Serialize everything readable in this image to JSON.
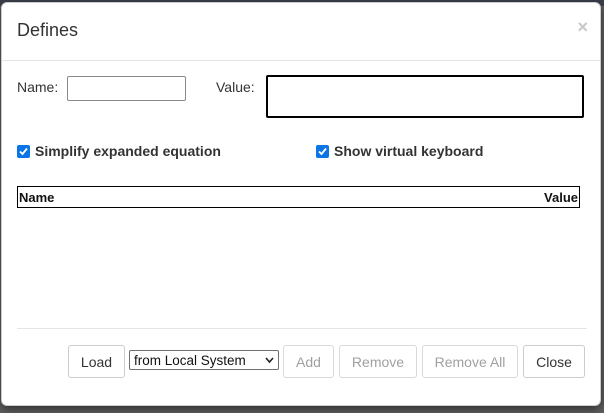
{
  "dialog": {
    "title": "Defines",
    "close_glyph": "×"
  },
  "form": {
    "name_label": "Name:",
    "name_value": "",
    "value_label": "Value:",
    "value_value": ""
  },
  "options": {
    "simplify_label": "Simplify expanded equation",
    "simplify_checked": true,
    "keyboard_label": "Show virtual keyboard",
    "keyboard_checked": true
  },
  "table": {
    "columns": [
      "Name",
      "Value"
    ],
    "rows": []
  },
  "footer": {
    "load_label": "Load",
    "source_selected": "from Local System",
    "add_label": "Add",
    "remove_label": "Remove",
    "remove_all_label": "Remove All",
    "close_label": "Close"
  },
  "colors": {
    "checkbox_accent": "#0b75e8",
    "disabled_text": "#a0a0a0"
  },
  "icons": {
    "close": "close-icon",
    "check": "checkmark-icon",
    "dropdown": "chevron-down-icon"
  }
}
